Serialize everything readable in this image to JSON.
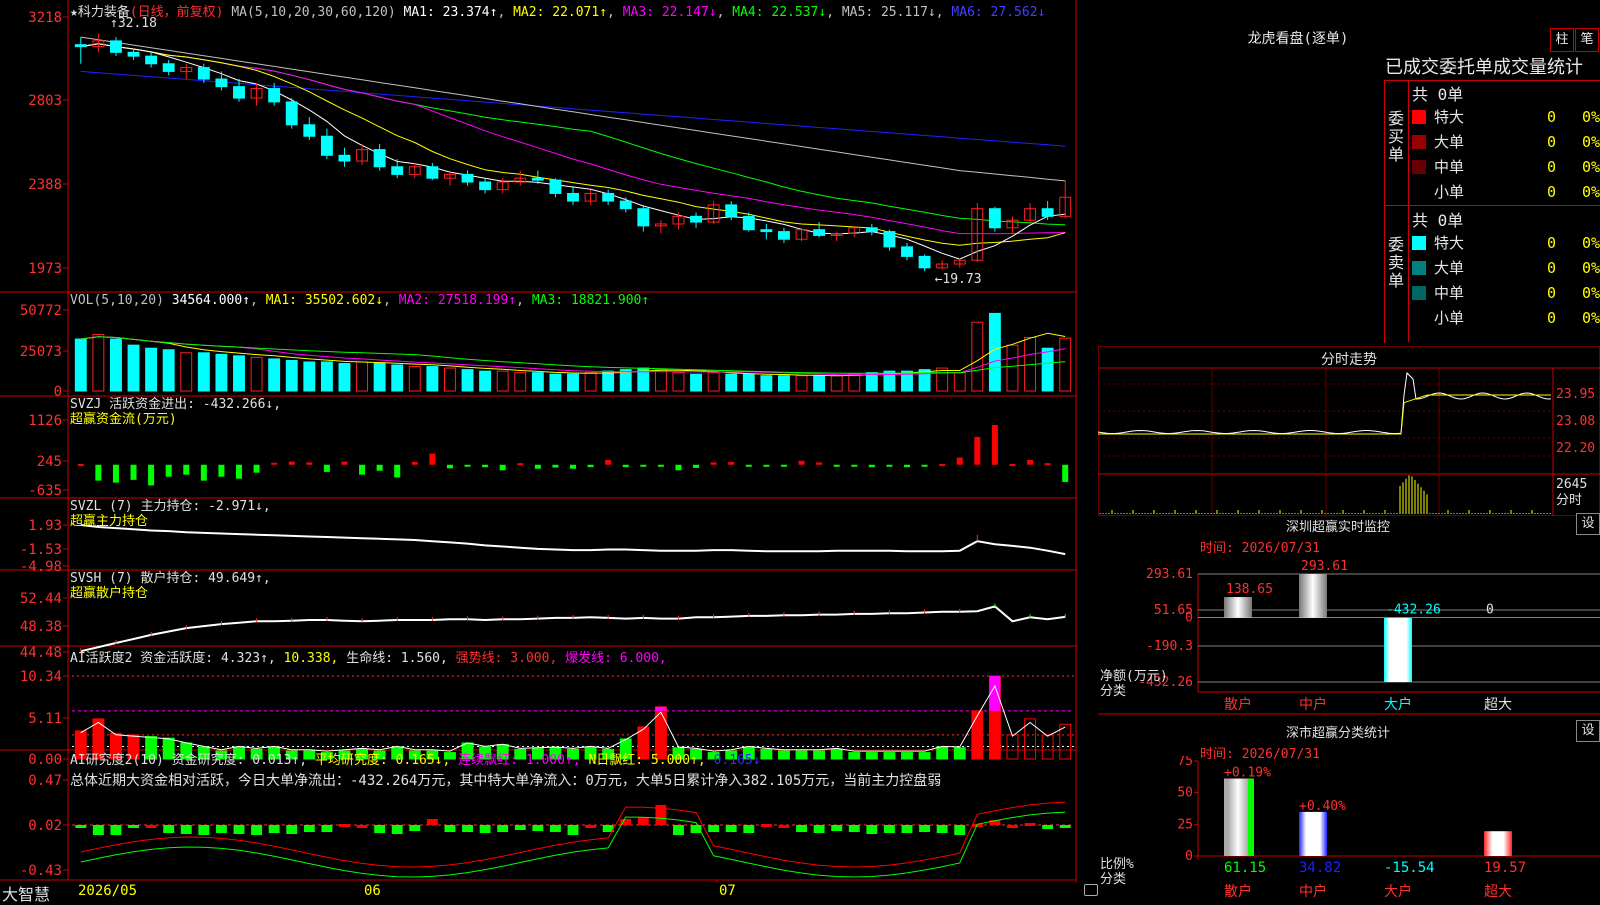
{
  "app": {
    "brand": "大智慧"
  },
  "stock": {
    "name": "科力装备",
    "period": "(日线，前复权)"
  },
  "colors": {
    "up": "#ff2020",
    "down": "#00ffff",
    "bg": "#000000",
    "grid": "#cc0000",
    "ma1": "#ffffff",
    "ma2": "#ffff00",
    "ma3": "#ff00ff",
    "ma4": "#00ff00",
    "ma5": "#c0c0c0",
    "ma6": "#2020ff"
  },
  "main_panel": {
    "ma_header": {
      "label": "MA(5,10,20,30,60,120)",
      "ma1": "MA1: 23.374↑",
      "ma2": "MA2: 22.071↑",
      "ma3": "MA3: 22.147↓",
      "ma4": "MA4: 22.537↓",
      "ma5": "MA5: 25.117↓",
      "ma6": "MA6: 27.562↓"
    },
    "y_ticks": [
      "3218",
      "2803",
      "2388",
      "1973"
    ],
    "high_label": "32.18",
    "low_label": "←19.73"
  },
  "vol_panel": {
    "header": {
      "label": "VOL(5,10,20)",
      "value": "34564.000↑",
      "ma1": "MA1: 35502.602↓",
      "ma2": "MA2: 27518.199↑",
      "ma3": "MA3: 18821.900↑"
    },
    "y_ticks": [
      "50772",
      "25073",
      "0"
    ]
  },
  "svzj_panel": {
    "header": {
      "label": "SVZJ  活跃资金进出: -432.266↓,",
      "sub": "超赢资金流(万元)"
    },
    "y_ticks": [
      "1126",
      "245",
      "-635"
    ]
  },
  "svzl_panel": {
    "header": {
      "label": "SVZL (7) 主力持仓: -2.971↓,",
      "sub": "超赢主力持仓"
    },
    "y_ticks": [
      "1.93",
      "-1.53",
      "-4.98"
    ]
  },
  "svsh_panel": {
    "header": {
      "label": "SVSH (7) 散户持仓: 49.649↑,",
      "sub": "超赢散户持仓"
    },
    "y_ticks": [
      "52.44",
      "48.38",
      "44.48"
    ]
  },
  "ai_active_panel": {
    "header": {
      "label": "AI活跃度2 资金活跃度: 4.323↑,",
      "v2": "10.338,",
      "v3": "生命线: 1.560,",
      "v4": "强势线: 3.000,",
      "v5": "爆发线: 6.000,"
    },
    "y_ticks": [
      "10.34",
      "5.11",
      "0.00"
    ]
  },
  "ai_research_panel": {
    "header": {
      "label": "AI研究度2(10) 资金研究度: 0.013↑,",
      "v2": "平均研究度: 0.165↓,",
      "v3": "连续飘红: 1.000↑,",
      "v4": "N日飘红: 5.000↑,",
      "v5": "0.165↓"
    },
    "summary": "总体近期大资金相对活跃，今日大单净流出：-432.264万元，其中特大单净流入：0万元，大单5日累计净入382.105万元，当前主力控盘弱",
    "y_ticks": [
      "0.47",
      "0.02",
      "-0.43"
    ]
  },
  "date_axis": {
    "labels": [
      "2026/05",
      "06",
      "07"
    ]
  },
  "dragon_tiger": {
    "title": "龙虎看盘(逐单)",
    "btn_bar": "柱",
    "btn_pen": "笔",
    "stats_title": "已成交委托单成交量统计",
    "buy": {
      "label": "委买单",
      "total": "共 0单",
      "rows": [
        {
          "name": "特大",
          "count": "0",
          "pct": "0%",
          "color": "#ff0000"
        },
        {
          "name": "大单",
          "count": "0",
          "pct": "0%",
          "color": "#990000"
        },
        {
          "name": "中单",
          "count": "0",
          "pct": "0%",
          "color": "#660000"
        },
        {
          "name": "小单",
          "count": "0",
          "pct": "0%",
          "color": "#000000"
        }
      ]
    },
    "sell": {
      "label": "委卖单",
      "total": "共 0单",
      "rows": [
        {
          "name": "特大",
          "count": "0",
          "pct": "0%",
          "color": "#00ffff"
        },
        {
          "name": "大单",
          "count": "0",
          "pct": "0%",
          "color": "#008080"
        },
        {
          "name": "中单",
          "count": "0",
          "pct": "0%",
          "color": "#006666"
        },
        {
          "name": "小单",
          "count": "0",
          "pct": "0%",
          "color": "#000000"
        }
      ]
    }
  },
  "intraday": {
    "title": "分时走势",
    "y_ticks": [
      "23.95",
      "23.08",
      "22.20",
      "2645"
    ],
    "vol_label": "分时"
  },
  "sz_monitor": {
    "title": "深圳超赢实时监控",
    "set": "设",
    "time": "时间: 2026/07/31",
    "y_ticks": [
      "293.61",
      "51.65",
      "0",
      "-190.3",
      "-432.26"
    ],
    "ylabel": "净额(万元)",
    "xlabel": "分类",
    "bar_values": [
      "138.65",
      "293.61",
      "-432.26",
      "0"
    ],
    "categories": [
      "散户",
      "中户",
      "大户",
      "超大"
    ]
  },
  "sz_class": {
    "title": "深市超赢分类统计",
    "set": "设",
    "time": "时间: 2026/07/31",
    "y_ticks": [
      "75",
      "50",
      "25",
      "0"
    ],
    "ylabel": "比例%",
    "xlabel": "分类",
    "top_labels": [
      "+0.19%",
      "+0.40%"
    ],
    "bottom_values": [
      "61.15",
      "34.82",
      "-15.54",
      "19.57"
    ],
    "categories": [
      "散户",
      "中户",
      "大户",
      "超大"
    ]
  },
  "chart_data": [
    {
      "type": "candlestick",
      "title": "科力装备 (日线，前复权)",
      "ylim": [
        19.0,
        33.0
      ],
      "x": [
        "2026-05-06",
        "2026-07-31"
      ],
      "high": 32.18,
      "low": 19.73,
      "ohlc": [
        [
          31.6,
          32.0,
          30.6,
          31.5
        ],
        [
          31.5,
          32.18,
          31.2,
          31.8
        ],
        [
          31.8,
          32.0,
          31.0,
          31.2
        ],
        [
          31.2,
          31.4,
          30.8,
          31.0
        ],
        [
          31.0,
          31.2,
          30.4,
          30.6
        ],
        [
          30.6,
          30.8,
          30.0,
          30.2
        ],
        [
          30.2,
          30.6,
          29.8,
          30.4
        ],
        [
          30.4,
          30.6,
          29.6,
          29.8
        ],
        [
          29.8,
          30.2,
          29.2,
          29.4
        ],
        [
          29.4,
          29.8,
          28.6,
          28.8
        ],
        [
          28.8,
          29.6,
          28.4,
          29.3
        ],
        [
          29.3,
          29.6,
          28.4,
          28.6
        ],
        [
          28.6,
          28.8,
          27.2,
          27.4
        ],
        [
          27.4,
          27.8,
          26.6,
          26.8
        ],
        [
          26.8,
          27.2,
          25.6,
          25.8
        ],
        [
          25.8,
          26.2,
          25.2,
          25.5
        ],
        [
          25.5,
          26.4,
          25.3,
          26.1
        ],
        [
          26.1,
          26.4,
          25.0,
          25.2
        ],
        [
          25.2,
          25.6,
          24.6,
          24.8
        ],
        [
          24.8,
          25.4,
          24.6,
          25.2
        ],
        [
          25.2,
          25.4,
          24.5,
          24.6
        ],
        [
          24.6,
          25.0,
          24.2,
          24.8
        ],
        [
          24.8,
          25.0,
          24.2,
          24.4
        ],
        [
          24.4,
          24.6,
          23.8,
          24.0
        ],
        [
          24.0,
          24.6,
          23.8,
          24.4
        ],
        [
          24.4,
          25.0,
          24.2,
          24.6
        ],
        [
          24.6,
          25.0,
          24.3,
          24.5
        ],
        [
          24.5,
          24.6,
          23.6,
          23.8
        ],
        [
          23.8,
          24.2,
          23.2,
          23.4
        ],
        [
          23.4,
          24.0,
          23.2,
          23.8
        ],
        [
          23.8,
          24.0,
          23.2,
          23.4
        ],
        [
          23.4,
          23.6,
          22.8,
          23.0
        ],
        [
          23.0,
          23.2,
          21.8,
          22.1
        ],
        [
          22.1,
          22.4,
          21.7,
          22.2
        ],
        [
          22.2,
          22.8,
          21.9,
          22.6
        ],
        [
          22.6,
          22.8,
          22.0,
          22.3
        ],
        [
          22.3,
          23.4,
          22.2,
          23.2
        ],
        [
          23.2,
          23.4,
          22.4,
          22.6
        ],
        [
          22.6,
          22.8,
          21.8,
          21.9
        ],
        [
          21.9,
          22.2,
          21.4,
          21.8
        ],
        [
          21.8,
          22.0,
          21.2,
          21.4
        ],
        [
          21.4,
          22.0,
          21.3,
          21.9
        ],
        [
          21.9,
          22.3,
          21.5,
          21.6
        ],
        [
          21.6,
          21.8,
          21.3,
          21.7
        ],
        [
          21.7,
          22.1,
          21.5,
          22.0
        ],
        [
          22.0,
          22.2,
          21.6,
          21.8
        ],
        [
          21.8,
          21.9,
          20.8,
          21.0
        ],
        [
          21.0,
          21.2,
          20.3,
          20.5
        ],
        [
          20.5,
          20.6,
          19.73,
          19.9
        ],
        [
          19.9,
          20.3,
          19.8,
          20.1
        ],
        [
          20.1,
          20.4,
          19.9,
          20.3
        ],
        [
          20.3,
          23.3,
          20.2,
          23.0
        ],
        [
          23.0,
          23.1,
          21.8,
          22.0
        ],
        [
          22.0,
          22.6,
          21.7,
          22.4
        ],
        [
          22.4,
          23.3,
          22.2,
          23.0
        ],
        [
          23.0,
          23.4,
          22.4,
          22.6
        ],
        [
          22.6,
          24.5,
          22.5,
          23.6
        ]
      ]
    },
    {
      "type": "bar",
      "title": "VOL(5,10,20)",
      "ylim": [
        0,
        53000
      ],
      "values": [
        34000,
        37000,
        34000,
        30000,
        28000,
        27000,
        25000,
        25000,
        24000,
        23000,
        22000,
        21000,
        20000,
        19000,
        19000,
        18000,
        19000,
        18000,
        17000,
        16000,
        16000,
        15000,
        14000,
        13000,
        13000,
        12000,
        12000,
        11000,
        11000,
        12000,
        13000,
        14000,
        15000,
        14000,
        12000,
        11000,
        12000,
        11000,
        11000,
        10000,
        10000,
        10000,
        10000,
        10000,
        11000,
        12000,
        13000,
        13000,
        14000,
        15000,
        12000,
        45000,
        50772,
        30000,
        35000,
        28000,
        34564
      ]
    },
    {
      "type": "bar",
      "title": "超赢资金流(万元)",
      "ylim": [
        -635,
        1126
      ],
      "values": [
        20,
        -400,
        -450,
        -380,
        -520,
        -300,
        -250,
        -400,
        -300,
        -350,
        -200,
        50,
        80,
        60,
        -180,
        80,
        -250,
        -150,
        -320,
        70,
        280,
        -90,
        -50,
        -60,
        -140,
        40,
        -100,
        -70,
        -100,
        -60,
        120,
        -60,
        -50,
        -50,
        -140,
        -80,
        60,
        70,
        -50,
        -40,
        -20,
        100,
        60,
        -30,
        -40,
        -60,
        -20,
        -60,
        -30,
        20,
        180,
        700,
        1000,
        20,
        120,
        40,
        -432
      ]
    },
    {
      "type": "line",
      "title": "超赢主力持仓",
      "ylim": [
        -4.98,
        1.93
      ],
      "values": [
        1.93,
        1.6,
        1.4,
        1.2,
        1.0,
        0.9,
        0.7,
        0.6,
        0.5,
        0.4,
        0.3,
        0.2,
        0.1,
        0.0,
        -0.1,
        -0.2,
        -0.3,
        -0.4,
        -0.5,
        -0.6,
        -0.8,
        -1.0,
        -1.2,
        -1.5,
        -1.7,
        -1.9,
        -2.1,
        -2.2,
        -2.3,
        -2.3,
        -2.2,
        -2.2,
        -2.3,
        -2.4,
        -2.4,
        -2.4,
        -2.3,
        -2.3,
        -2.4,
        -2.5,
        -2.5,
        -2.5,
        -2.5,
        -2.4,
        -2.4,
        -2.4,
        -2.4,
        -2.5,
        -2.5,
        -2.5,
        -2.4,
        -0.8,
        -1.3,
        -1.6,
        -1.9,
        -2.4,
        -2.971
      ]
    },
    {
      "type": "line",
      "title": "超赢散户持仓",
      "ylim": [
        44.48,
        52.44
      ],
      "values": [
        44.6,
        45.2,
        45.8,
        46.4,
        47.0,
        47.5,
        48.0,
        48.3,
        48.6,
        48.8,
        49.0,
        49.0,
        49.1,
        49.2,
        49.2,
        49.1,
        49.0,
        49.1,
        49.2,
        49.2,
        49.2,
        49.3,
        49.3,
        49.2,
        49.3,
        49.3,
        49.4,
        49.5,
        49.5,
        49.6,
        49.5,
        49.4,
        49.5,
        49.4,
        49.4,
        49.6,
        49.6,
        49.7,
        49.8,
        49.8,
        49.9,
        49.9,
        50.0,
        50.0,
        50.1,
        50.1,
        50.2,
        50.2,
        50.3,
        50.4,
        50.4,
        50.5,
        51.2,
        49.0,
        49.6,
        49.3,
        49.649
      ]
    },
    {
      "type": "bar",
      "title": "AI活跃度2",
      "ylim": [
        0,
        10.34
      ],
      "values": [
        3.5,
        5.0,
        3.2,
        3.0,
        2.8,
        2.6,
        2.0,
        1.5,
        1.0,
        1.5,
        1.2,
        1.5,
        1.0,
        1.0,
        0.8,
        1.0,
        1.2,
        1.0,
        1.5,
        1.0,
        1.0,
        0.8,
        2.0,
        1.5,
        1.8,
        1.2,
        1.3,
        1.4,
        1.2,
        1.5,
        1.2,
        2.5,
        4.0,
        6.5,
        1.4,
        1.2,
        0.8,
        1.0,
        1.5,
        1.2,
        1.0,
        1.0,
        1.0,
        1.2,
        0.8,
        0.8,
        0.8,
        0.8,
        0.8,
        1.5,
        1.4,
        6.0,
        10.34,
        3.0,
        5.0,
        3.0,
        4.323
      ]
    },
    {
      "type": "bar",
      "title": "AI研究度2(10)",
      "ylim": [
        -0.43,
        0.47
      ],
      "values": [
        0.0,
        -0.08,
        -0.08,
        0.01,
        0.02,
        -0.06,
        -0.07,
        -0.08,
        -0.06,
        -0.07,
        -0.08,
        -0.06,
        -0.07,
        -0.05,
        -0.05,
        0.03,
        0.02,
        -0.06,
        -0.07,
        -0.04,
        0.08,
        -0.05,
        -0.05,
        -0.06,
        -0.05,
        -0.03,
        -0.04,
        -0.05,
        -0.08,
        0.02,
        -0.05,
        0.08,
        0.1,
        0.22,
        -0.08,
        -0.06,
        -0.05,
        -0.05,
        -0.06,
        0.03,
        0.02,
        -0.05,
        -0.06,
        -0.04,
        -0.05,
        -0.07,
        -0.06,
        -0.06,
        -0.05,
        -0.06,
        -0.08,
        0.03,
        0.07,
        0.02,
        0.04,
        -0.02,
        0.013
      ]
    }
  ]
}
